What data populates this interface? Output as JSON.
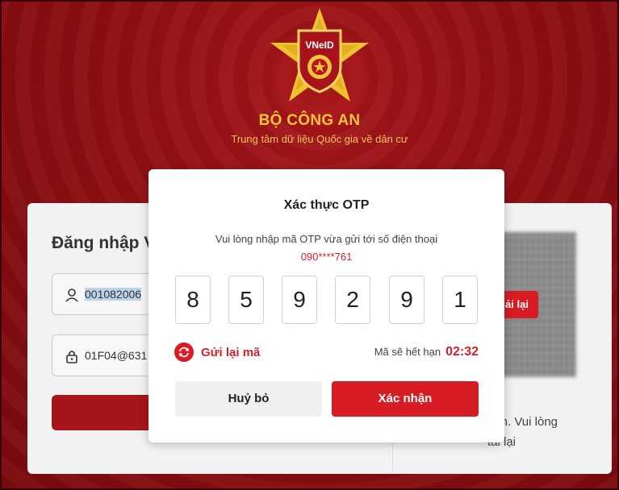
{
  "header": {
    "logo_text": "VNeID",
    "title": "BỘ CÔNG AN",
    "subtitle": "Trung tâm dữ liệu Quốc gia về dân cư"
  },
  "login": {
    "title_partial": "Đăng nhập V",
    "username_value": "001082006",
    "password_value": "01F04@631",
    "user_icon": "user-icon",
    "lock_icon": "lock-icon"
  },
  "qr": {
    "retry_label": "ải lại",
    "note_line1": "hạn. Vui lòng",
    "note_line2": "tải lại"
  },
  "otp_modal": {
    "title": "Xác thực OTP",
    "subtitle": "Vui lòng nhập mã OTP vừa gửi tới số điện thoại",
    "phone": "090****761",
    "digits": [
      "8",
      "5",
      "9",
      "2",
      "9",
      "1"
    ],
    "resend_label": "Gửi lại mã",
    "resend_icon": "refresh-icon",
    "expire_label": "Mã sẽ hết hạn",
    "expire_time": "02:32",
    "cancel_label": "Huỷ bỏ",
    "confirm_label": "Xác nhận"
  },
  "colors": {
    "accent_red": "#d71c23",
    "gold": "#f3c33f",
    "background_red": "#8a0d10"
  }
}
